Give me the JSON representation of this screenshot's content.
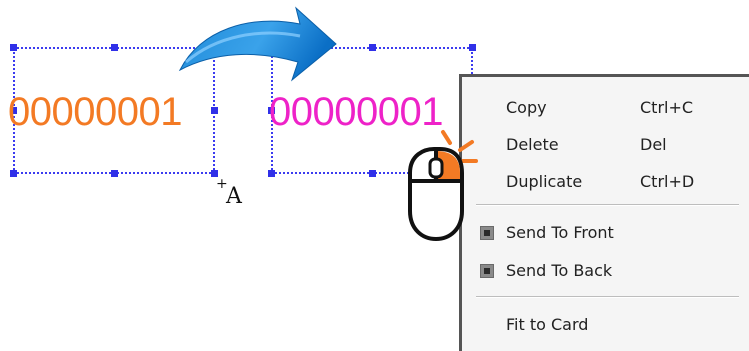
{
  "canvas": {
    "source_field": {
      "text": "00000001",
      "color": "#f37a24"
    },
    "target_field": {
      "text": "00000001",
      "color": "#ee22c8"
    },
    "selection_color": "#3030e8",
    "arrow_icon": "curved-arrow-icon",
    "cursor": {
      "plus": "+",
      "letter": "A"
    }
  },
  "context_menu": {
    "items": [
      {
        "label": "Copy",
        "shortcut": "Ctrl+C"
      },
      {
        "label": "Delete",
        "shortcut": "Del"
      },
      {
        "label": "Duplicate",
        "shortcut": "Ctrl+D"
      },
      {
        "label": "Send To Front",
        "icon": "send-to-front-icon"
      },
      {
        "label": "Send To Back",
        "icon": "send-to-back-icon"
      },
      {
        "label": "Fit to Card"
      }
    ]
  },
  "mouse_icon": {
    "name": "mouse-right-click-icon",
    "accent": "#f37a24"
  }
}
